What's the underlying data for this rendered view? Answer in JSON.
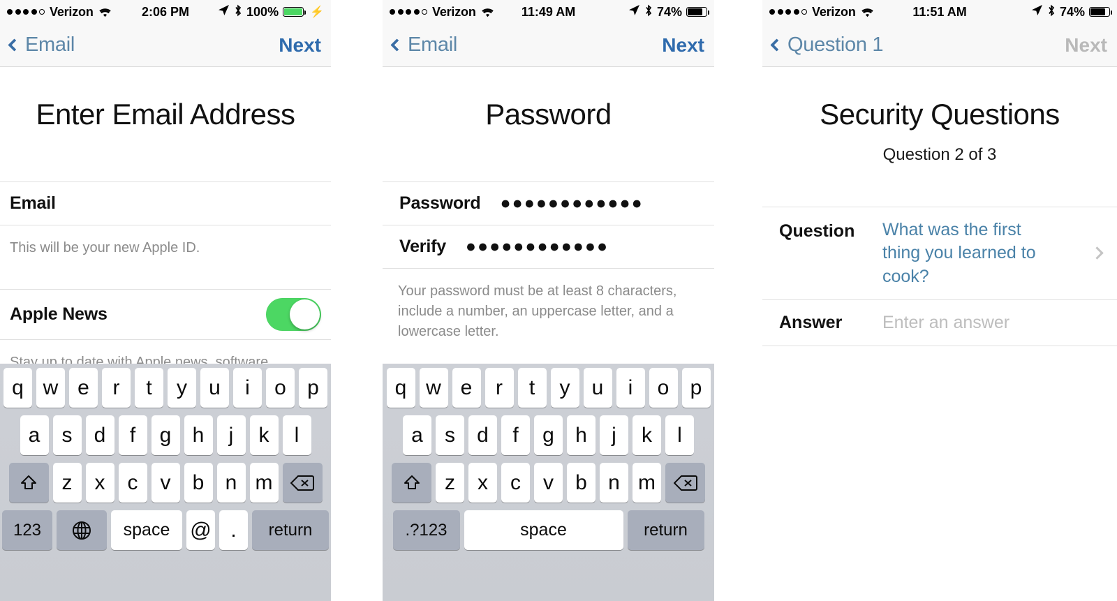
{
  "panels": [
    {
      "id": "email",
      "statusbar": {
        "carrier": "Verizon",
        "signal_filled": 4,
        "signal_empty": 1,
        "wifi_icon": "wifi-icon",
        "time": "2:06 PM",
        "location_icon": "location-arrow-icon",
        "bluetooth_icon": "bluetooth-icon",
        "battery_percent": "100%",
        "battery_level": 100,
        "battery_color": "#4cd763",
        "charging_icon": "lightning-bolt-icon"
      },
      "nav": {
        "back_label": "Email",
        "action_label": "Next",
        "action_disabled": false
      },
      "title": "Enter Email Address",
      "subtitle": "",
      "rows": [
        {
          "label": "Email",
          "value": ""
        }
      ],
      "hint": "This will be your new Apple ID.",
      "toggle_row": {
        "label": "Apple News",
        "on": true
      },
      "footer_hint": "Stay up to date with Apple news, software",
      "keyboard": {
        "type": "email",
        "row1": [
          "q",
          "w",
          "e",
          "r",
          "t",
          "y",
          "u",
          "i",
          "o",
          "p"
        ],
        "row2": [
          "a",
          "s",
          "d",
          "f",
          "g",
          "h",
          "j",
          "k",
          "l"
        ],
        "row3": [
          "z",
          "x",
          "c",
          "v",
          "b",
          "n",
          "m"
        ],
        "shift_icon": "shift-arrow-icon",
        "backspace_icon": "backspace-icon",
        "numbers_key": "123",
        "globe_icon": "globe-icon",
        "space_key": "space",
        "at_key": "@",
        "period_key": ".",
        "return_key": "return"
      }
    },
    {
      "id": "password",
      "statusbar": {
        "carrier": "Verizon",
        "signal_filled": 4,
        "signal_empty": 1,
        "wifi_icon": "wifi-icon",
        "time": "11:49 AM",
        "location_icon": "location-arrow-icon",
        "bluetooth_icon": "bluetooth-icon",
        "battery_percent": "74%",
        "battery_level": 74,
        "battery_color": "#000000",
        "charging_icon": ""
      },
      "nav": {
        "back_label": "Email",
        "action_label": "Next",
        "action_disabled": false
      },
      "title": "Password",
      "subtitle": "",
      "rows": [
        {
          "label": "Password",
          "value": "●●●●●●●●●●●●"
        },
        {
          "label": "Verify",
          "value": "●●●●●●●●●●●●"
        }
      ],
      "hint": "Your password must be at least 8 characters, include a number, an uppercase letter, and a lowercase letter.",
      "keyboard": {
        "type": "default",
        "row1": [
          "q",
          "w",
          "e",
          "r",
          "t",
          "y",
          "u",
          "i",
          "o",
          "p"
        ],
        "row2": [
          "a",
          "s",
          "d",
          "f",
          "g",
          "h",
          "j",
          "k",
          "l"
        ],
        "row3": [
          "z",
          "x",
          "c",
          "v",
          "b",
          "n",
          "m"
        ],
        "shift_icon": "shift-arrow-icon",
        "backspace_icon": "backspace-icon",
        "symbols_key": ".?123",
        "space_key": "space",
        "return_key": "return"
      }
    },
    {
      "id": "security",
      "statusbar": {
        "carrier": "Verizon",
        "signal_filled": 4,
        "signal_empty": 1,
        "wifi_icon": "wifi-icon",
        "time": "11:51 AM",
        "location_icon": "location-arrow-icon",
        "bluetooth_icon": "bluetooth-icon",
        "battery_percent": "74%",
        "battery_level": 74,
        "battery_color": "#000000",
        "charging_icon": ""
      },
      "nav": {
        "back_label": "Question 1",
        "action_label": "Next",
        "action_disabled": true
      },
      "title": "Security Questions",
      "subtitle": "Question 2 of 3",
      "question": {
        "label": "Question",
        "value": "What was the first thing you learned to cook?"
      },
      "answer": {
        "label": "Answer",
        "placeholder": "Enter an answer",
        "value": ""
      }
    }
  ],
  "colors": {
    "nav_tint": "#2f6bad",
    "back_tint": "#5d87a8",
    "disabled": "#b9b9b9",
    "toggle_on": "#4cd763",
    "link_blue": "#4a82a8",
    "keyboard_bg": "#cdd0d6",
    "key_gray": "#a8aebb"
  }
}
